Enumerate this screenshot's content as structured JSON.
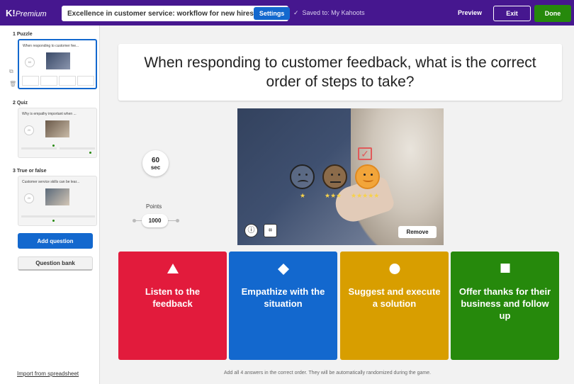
{
  "header": {
    "logo_mark": "K!",
    "logo_text": "Premium",
    "title": "Excellence in customer service: workflow for new hires",
    "settings_label": "Settings",
    "saved_text": "Saved to: My Kahoots",
    "preview_label": "Preview",
    "exit_label": "Exit",
    "done_label": "Done"
  },
  "sidebar": {
    "slides": [
      {
        "label": "1  Puzzle",
        "title": "When responding to customer fee...",
        "timer": "60"
      },
      {
        "label": "2  Quiz",
        "title": "Why is empathy important when ...",
        "timer": "20"
      },
      {
        "label": "3  True or false",
        "title": "Customer service skills can be lear...",
        "timer": "20"
      }
    ],
    "add_question_label": "Add question",
    "question_bank_label": "Question bank",
    "import_label": "Import from spreadsheet"
  },
  "question": {
    "text": "When responding to customer feedback, what is the correct order of steps to take?"
  },
  "media": {
    "remove_label": "Remove",
    "star_1": "★",
    "star_2": "★★★",
    "star_3": "★★★★★"
  },
  "timer": {
    "value": "60",
    "unit": "sec"
  },
  "points": {
    "label": "Points",
    "value": "1000"
  },
  "answers": [
    {
      "text": "Listen to the feedback",
      "shape": "triangle",
      "color": "#e21b3c"
    },
    {
      "text": "Empathize with the situation",
      "shape": "diamond",
      "color": "#1368ce"
    },
    {
      "text": "Suggest and execute a solution",
      "shape": "circle",
      "color": "#d89e00"
    },
    {
      "text": "Offer thanks for their business and follow up",
      "shape": "square",
      "color": "#26890c"
    }
  ],
  "footnote": "Add all 4 answers in the correct order. They will be automatically randomized during the game."
}
